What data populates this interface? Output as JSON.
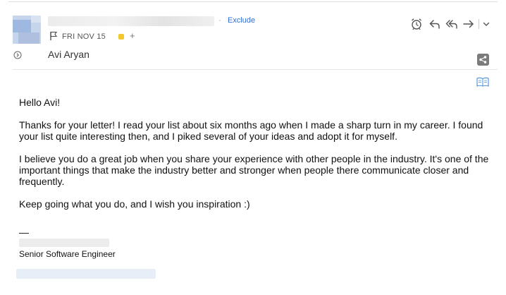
{
  "header": {
    "exclude_label": "Exclude",
    "date": "FRI NOV 15",
    "tag_color": "#f2c72f",
    "add_tag_symbol": "+",
    "separator_symbol": "·"
  },
  "toolbar": {
    "icons": [
      "alarm-clock-icon",
      "reply-icon",
      "reply-all-icon",
      "forward-icon",
      "chevron-down-icon"
    ]
  },
  "recipient": {
    "name": "Avi Aryan"
  },
  "message": {
    "greeting": "Hello Avi!",
    "paragraphs": [
      "Thanks for your letter! I read your list about six months ago when I made a sharp turn in my career. I found your list quite interesting then, and I piked several of your ideas and adopt it for myself.",
      "I believe you do a great job when you share your experience with other people in the industry. It's one of the important things that make the industry better and stronger when people there communicate closer and frequently.",
      "Keep going what you do, and I wish you inspiration :)"
    ]
  },
  "signature": {
    "dash": "—",
    "title": "Senior Software Engineer"
  },
  "colors": {
    "link": "#2f6fce",
    "icon_gray": "#555555",
    "share_bg": "#7b7b7b",
    "reader_icon": "#4a90d9"
  }
}
